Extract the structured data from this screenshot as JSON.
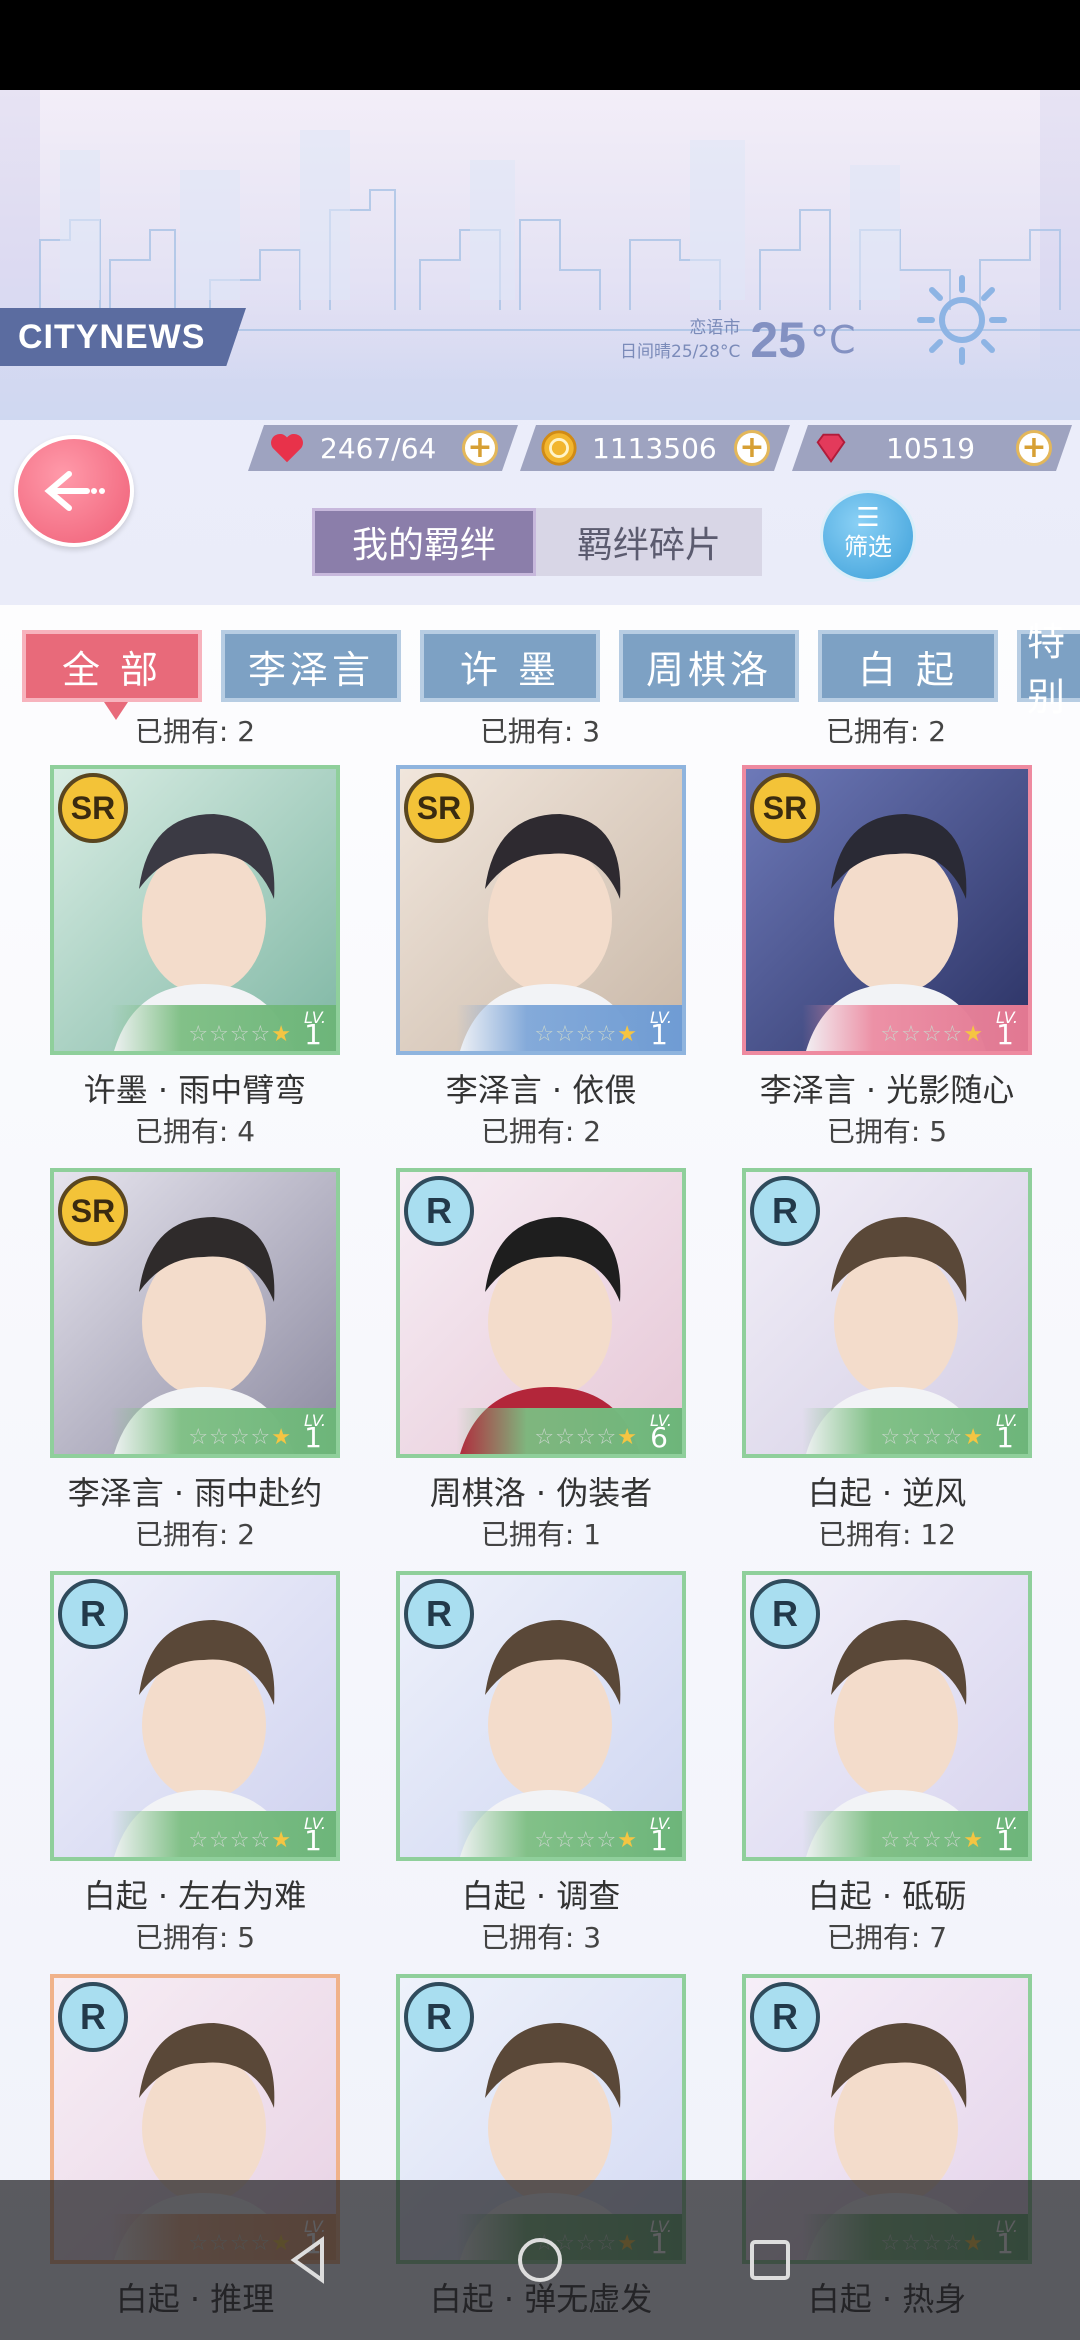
{
  "header": {
    "brand": "CITYNEWS",
    "weather_city": "恋语市",
    "weather_detail": "日间晴25/28°C",
    "temperature": "25",
    "temperature_unit": "°C"
  },
  "currencies": [
    {
      "icon": "heart-icon",
      "value": "2467/64"
    },
    {
      "icon": "gold-coin-icon",
      "value": "1113506"
    },
    {
      "icon": "diamond-icon",
      "value": "10519"
    }
  ],
  "tabs": {
    "my_bonds": "我的羁绊",
    "bond_fragments": "羁绊碎片"
  },
  "filter": {
    "icon": "filter-icon",
    "label": "筛选"
  },
  "character_tabs": [
    {
      "label": "全 部",
      "active": true
    },
    {
      "label": "李泽言",
      "active": false
    },
    {
      "label": "许 墨",
      "active": false
    },
    {
      "label": "周棋洛",
      "active": false
    },
    {
      "label": "白 起",
      "active": false
    },
    {
      "label": "特别",
      "active": false
    }
  ],
  "top_owned": [
    "已拥有: 2",
    "已拥有: 3",
    "已拥有: 2"
  ],
  "cards": [
    {
      "rarity": "SR",
      "name": "许墨 · 雨中臂弯",
      "owned": "已拥有: 4",
      "lv_label": "LV.",
      "level": "1",
      "stars": 1,
      "frame": "green"
    },
    {
      "rarity": "SR",
      "name": "李泽言 · 依偎",
      "owned": "已拥有: 2",
      "lv_label": "LV.",
      "level": "1",
      "stars": 1,
      "frame": "blue"
    },
    {
      "rarity": "SR",
      "name": "李泽言 · 光影随心",
      "owned": "已拥有: 5",
      "lv_label": "LV.",
      "level": "1",
      "stars": 1,
      "frame": "pink"
    },
    {
      "rarity": "SR",
      "name": "李泽言 · 雨中赴约",
      "owned": "已拥有: 2",
      "lv_label": "LV.",
      "level": "1",
      "stars": 1,
      "frame": "green"
    },
    {
      "rarity": "R",
      "name": "周棋洛 · 伪装者",
      "owned": "已拥有: 1",
      "lv_label": "LV.",
      "level": "6",
      "stars": 1,
      "frame": "green"
    },
    {
      "rarity": "R",
      "name": "白起 · 逆风",
      "owned": "已拥有: 12",
      "lv_label": "LV.",
      "level": "1",
      "stars": 1,
      "frame": "green"
    },
    {
      "rarity": "R",
      "name": "白起 · 左右为难",
      "owned": "已拥有: 5",
      "lv_label": "LV.",
      "level": "1",
      "stars": 1,
      "frame": "green"
    },
    {
      "rarity": "R",
      "name": "白起 · 调查",
      "owned": "已拥有: 3",
      "lv_label": "LV.",
      "level": "1",
      "stars": 1,
      "frame": "green"
    },
    {
      "rarity": "R",
      "name": "白起 · 砥砺",
      "owned": "已拥有: 7",
      "lv_label": "LV.",
      "level": "1",
      "stars": 1,
      "frame": "green"
    },
    {
      "rarity": "R",
      "name": "白起 · 推理",
      "owned": "",
      "lv_label": "LV.",
      "level": "1",
      "stars": 1,
      "frame": "orange"
    },
    {
      "rarity": "R",
      "name": "白起 · 弹无虚发",
      "owned": "",
      "lv_label": "LV.",
      "level": "1",
      "stars": 1,
      "frame": "green"
    },
    {
      "rarity": "R",
      "name": "白起 · 热身",
      "owned": "",
      "lv_label": "LV.",
      "level": "1",
      "stars": 1,
      "frame": "green"
    }
  ],
  "nav": {
    "back": "nav-back-icon",
    "home": "nav-home-icon",
    "recents": "nav-recents-icon"
  },
  "colors": {
    "active_tab": "#e86a7a",
    "character_tab": "#7da1c4",
    "sr_badge": "#f3c338",
    "r_badge": "#a9def0"
  }
}
